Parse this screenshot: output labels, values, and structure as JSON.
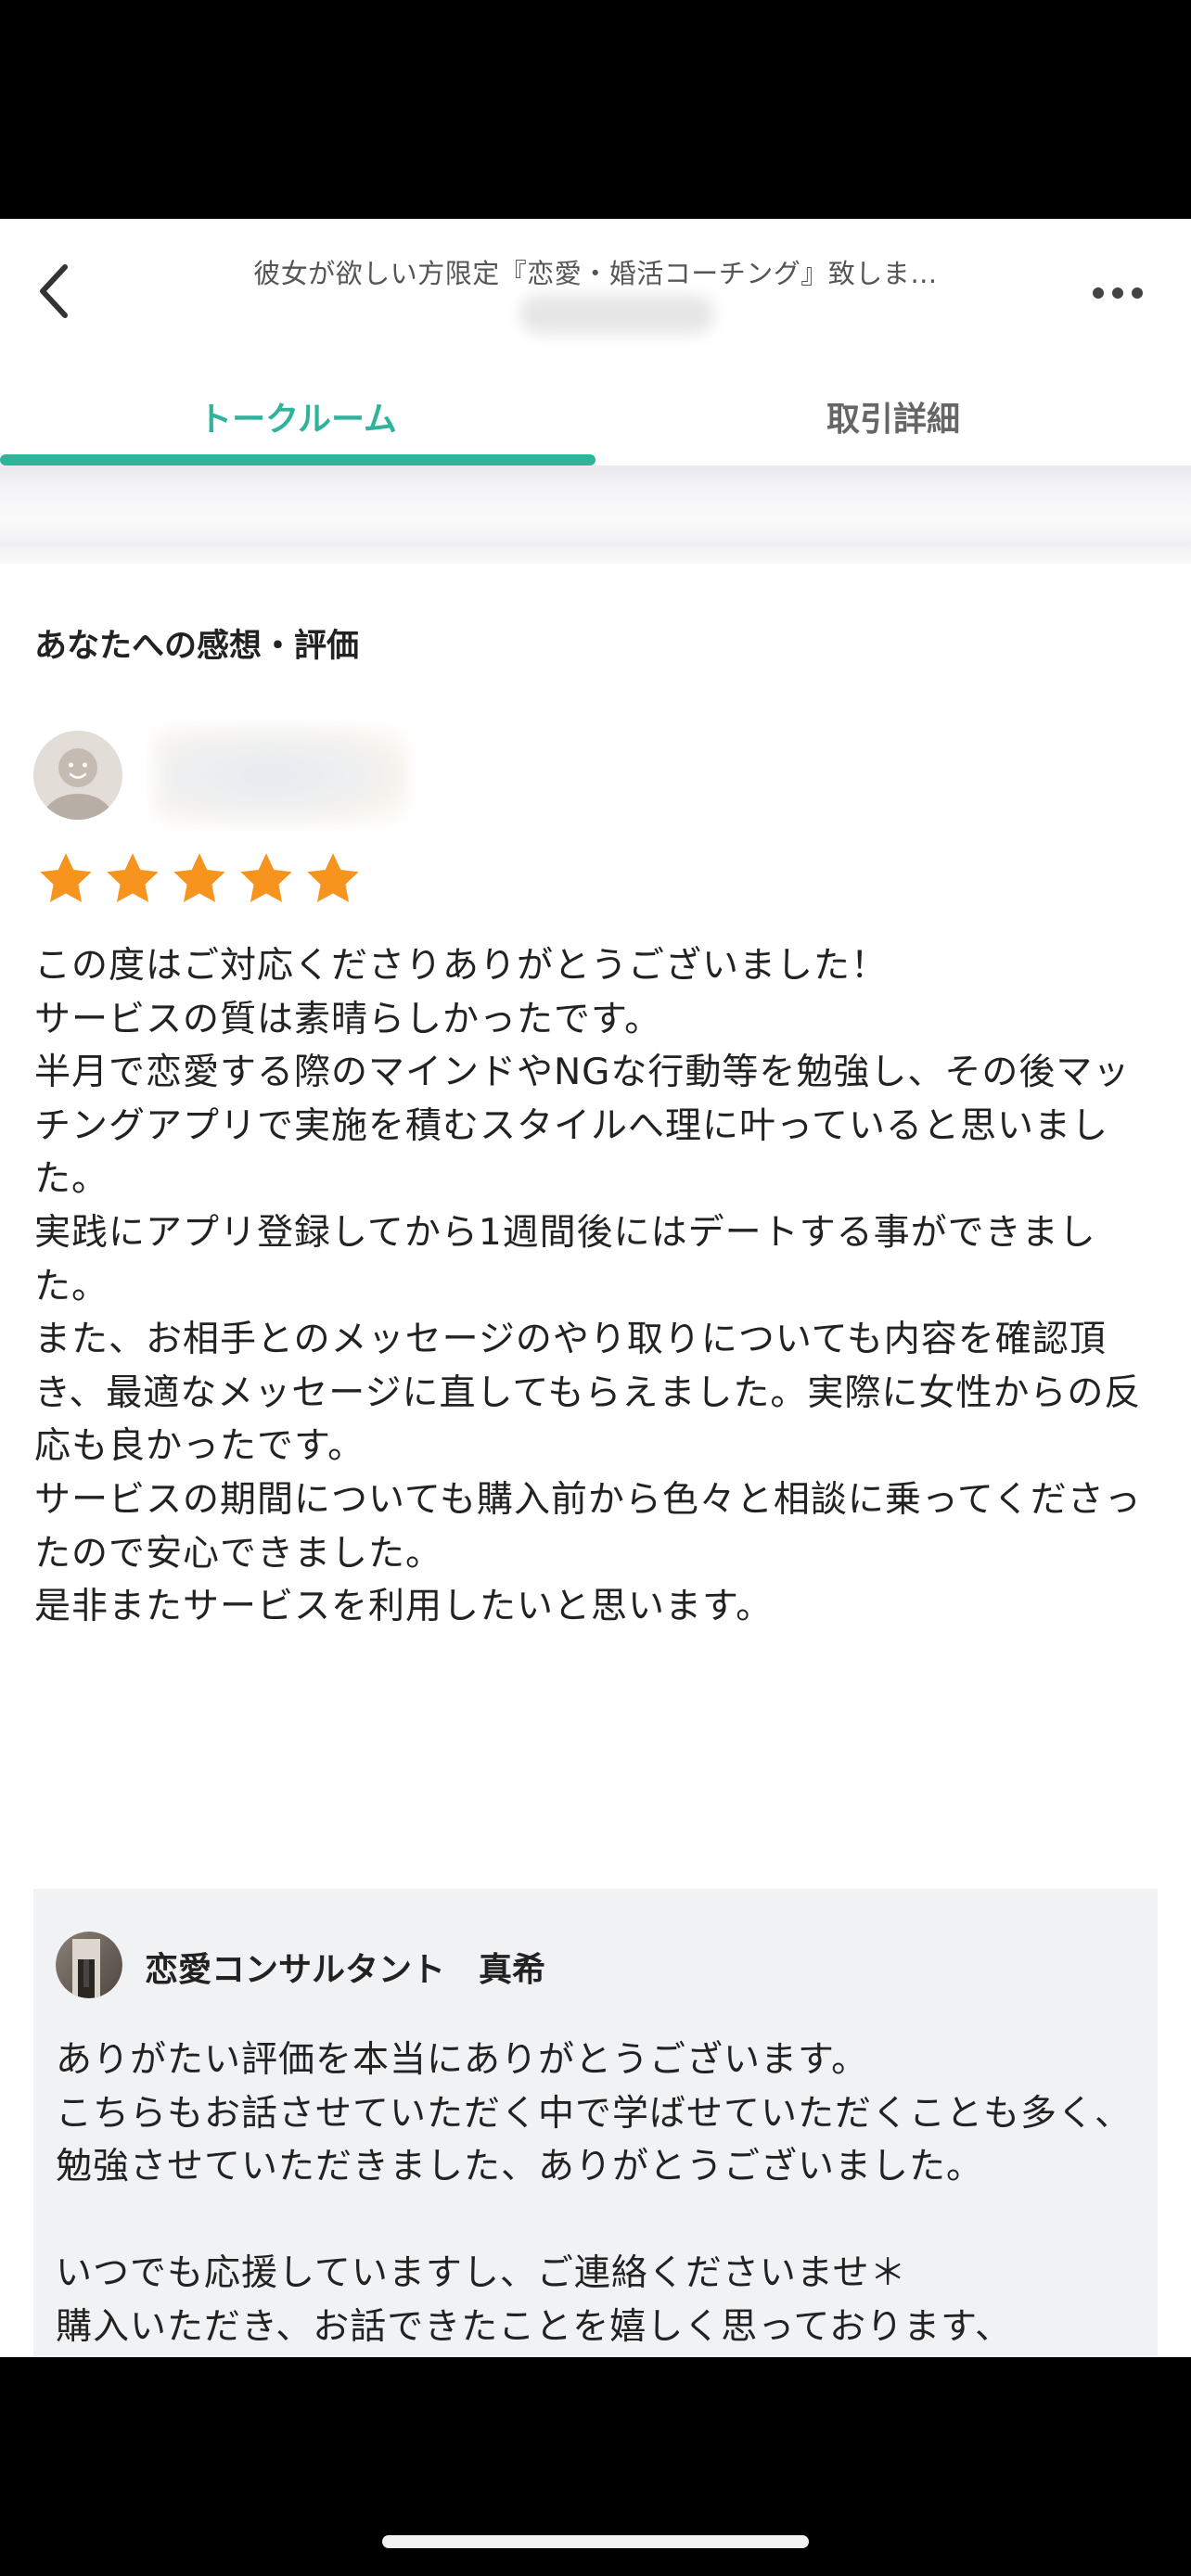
{
  "header": {
    "title": "彼女が欲しい方限定『恋愛・婚活コーチング』致しま…"
  },
  "tabs": [
    {
      "label": "トークルーム",
      "active": true
    },
    {
      "label": "取引詳細",
      "active": false
    }
  ],
  "review": {
    "section_title": "あなたへの感想・評価",
    "rating": 5,
    "rating_max": 5,
    "star_color": "#f7941d",
    "text": "この度はご対応くださりありがとうございました！\nサービスの質は素晴らしかったです。\n半月で恋愛する際のマインドやNGな行動等を勉強し、その後マッチングアプリで実施を積むスタイルへ理に叶っていると思いました。\n実践にアプリ登録してから1週間後にはデートする事ができました。\nまた、お相手とのメッセージのやり取りについても内容を確認頂き、最適なメッセージに直してもらえました。実際に女性からの反応も良かったです。\nサービスの期間についても購入前から色々と相談に乗ってくださったので安心できました。\n是非またサービスを利用したいと思います。"
  },
  "reply": {
    "name": "恋愛コンサルタント　真希",
    "text": "ありがたい評価を本当にありがとうございます。\nこちらもお話させていただく中で学ばせていただくことも多く、\n勉強させていただきました、ありがとうございました。\n\nいつでも応援していますし、ご連絡くださいませ＊\n購入いただき、お話できたことを嬉しく思っております、\nこの度はありがとうございました！"
  },
  "colors": {
    "accent": "#2fb39a",
    "reply_bg": "#f1f2f4"
  }
}
